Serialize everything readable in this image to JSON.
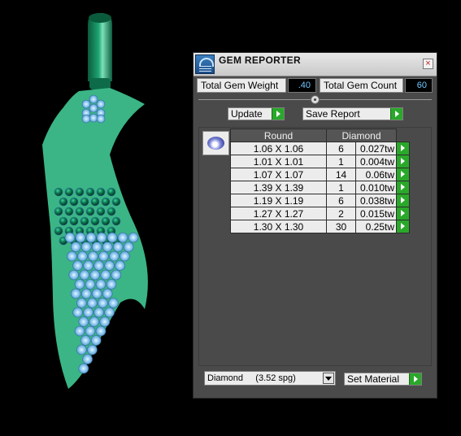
{
  "panel": {
    "title": "GEM REPORTER",
    "close_glyph": "×",
    "total_weight_label": "Total Gem Weight",
    "total_weight_value": ".40",
    "total_count_label": "Total Gem Count",
    "total_count_value": "60",
    "update_label": "Update",
    "save_report_label": "Save Report",
    "set_material_label": "Set Material",
    "material_selected": "Diamond     (3.52 spg)"
  },
  "report": {
    "shape": "Round",
    "material": "Diamond",
    "rows": [
      {
        "size": "1.06 X 1.06",
        "count": "6",
        "weight": "0.027tw"
      },
      {
        "size": "1.01 X 1.01",
        "count": "1",
        "weight": "0.004tw"
      },
      {
        "size": "1.07 X 1.07",
        "count": "14",
        "weight": "0.06tw"
      },
      {
        "size": "1.39 X 1.39",
        "count": "1",
        "weight": "0.010tw"
      },
      {
        "size": "1.19 X 1.19",
        "count": "6",
        "weight": "0.038tw"
      },
      {
        "size": "1.27 X 1.27",
        "count": "2",
        "weight": "0.015tw"
      },
      {
        "size": "1.30 X 1.30",
        "count": "30",
        "weight": "0.25tw"
      }
    ]
  },
  "colors": {
    "accent_green": "#2aa82a",
    "value_text": "#6ec6ff",
    "pendant_green": "#3bb585",
    "gem_blue": "#8ec8ef"
  },
  "icons": {
    "title": "gem-reporter-icon",
    "shape": "oval-gem-icon",
    "close": "close-icon",
    "button_arrow": "play-arrow-icon"
  }
}
